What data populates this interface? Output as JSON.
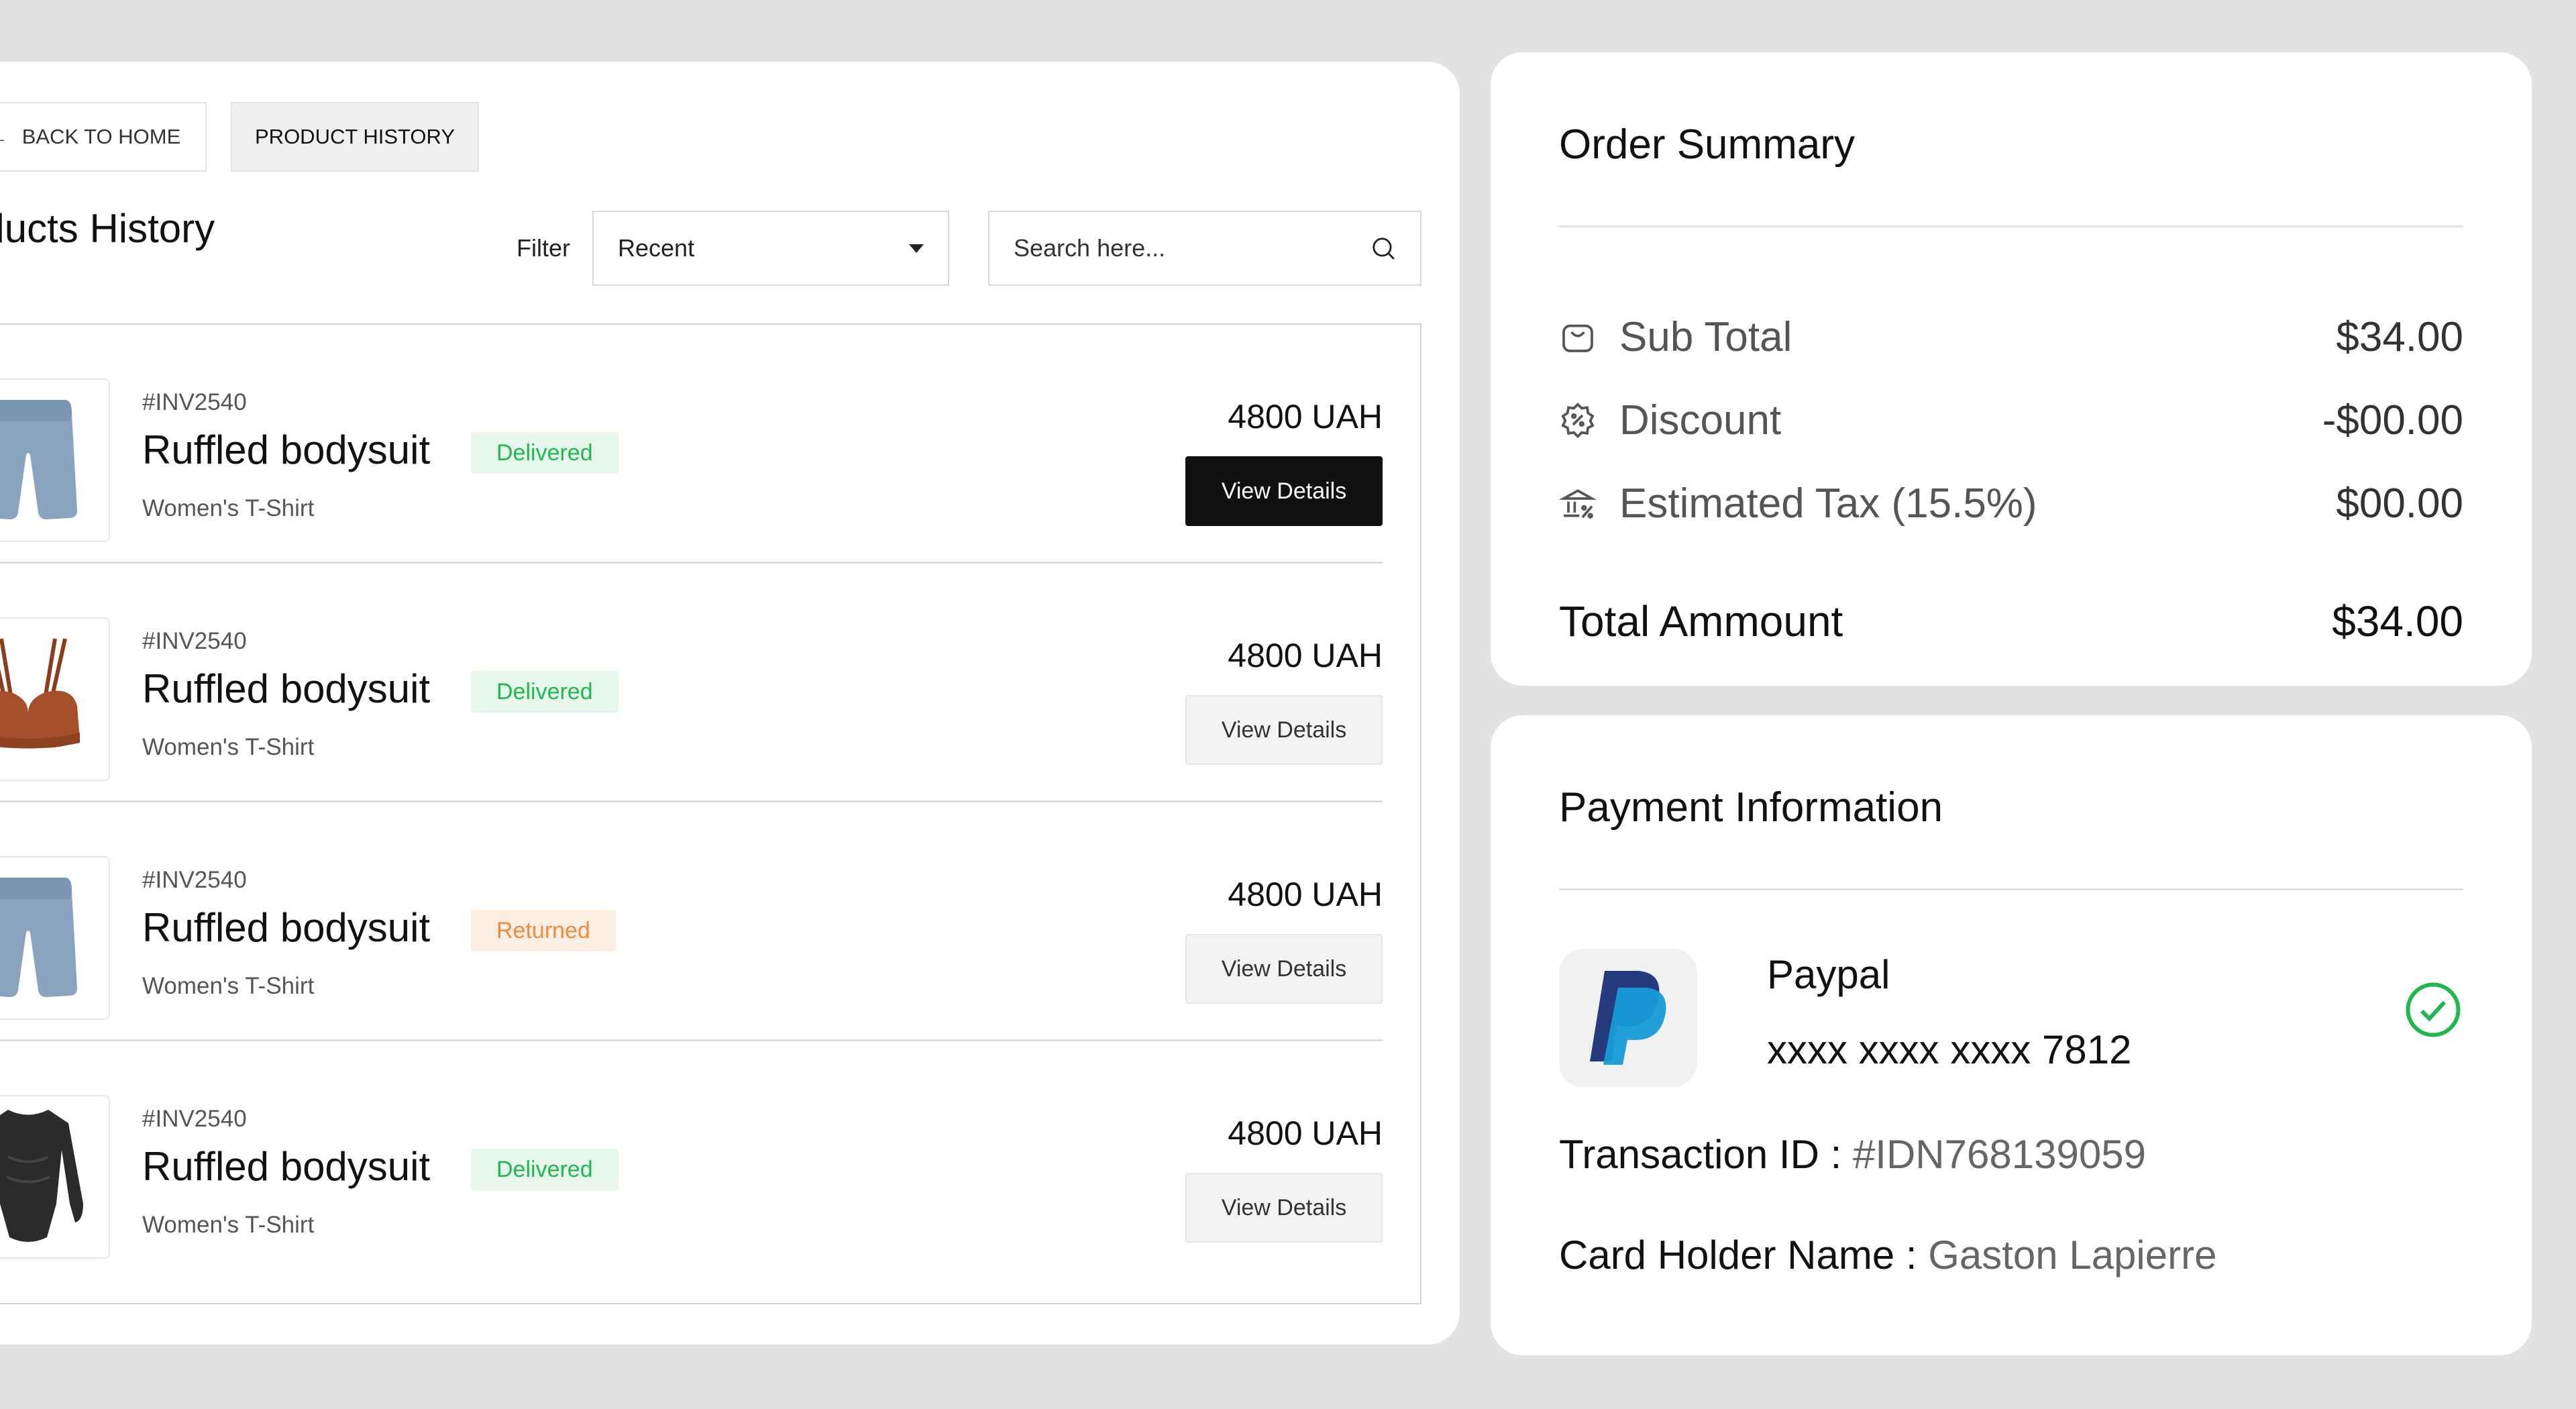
{
  "breadcrumb": {
    "back_label": "BACK TO HOME",
    "current_label": "PRODUCT HISTORY"
  },
  "products": {
    "title": "Products History",
    "filter_label": "Filter",
    "filter_value": "Recent",
    "search_placeholder": "Search here...",
    "items": [
      {
        "invoice": "#INV2540",
        "name": "Ruffled bodysuit",
        "status": "Delivered",
        "category": "Women's T-Shirt",
        "price": "4800 UAH",
        "button": "View Details",
        "image": "shorts-image"
      },
      {
        "invoice": "#INV2540",
        "name": "Ruffled bodysuit",
        "status": "Delivered",
        "category": "Women's T-Shirt",
        "price": "4800 UAH",
        "button": "View Details",
        "image": "bra-image"
      },
      {
        "invoice": "#INV2540",
        "name": "Ruffled bodysuit",
        "status": "Returned",
        "category": "Women's T-Shirt",
        "price": "4800 UAH",
        "button": "View Details",
        "image": "shorts-image"
      },
      {
        "invoice": "#INV2540",
        "name": "Ruffled bodysuit",
        "status": "Delivered",
        "category": "Women's T-Shirt",
        "price": "4800 UAH",
        "button": "View Details",
        "image": "bodysuit-image"
      }
    ]
  },
  "order_summary": {
    "title": "Order Summary",
    "rows": [
      {
        "label": "Sub Total",
        "value": "$34.00",
        "icon": "bag-icon"
      },
      {
        "label": "Discount",
        "value": "-$00.00",
        "icon": "discount-badge-icon"
      },
      {
        "label": "Estimated Tax (15.5%)",
        "value": "$00.00",
        "icon": "bank-tax-icon"
      }
    ],
    "total_label": "Total Ammount",
    "total_value": "$34.00"
  },
  "payment": {
    "title": "Payment Information",
    "method": "Paypal",
    "card_number": "xxxx xxxx xxxx 7812",
    "transaction_label": "Transaction ID :",
    "transaction_value": "#IDN768139059",
    "holder_label": "Card Holder Name :",
    "holder_value": "Gaston Lapierre"
  },
  "colors": {
    "delivered": "#1fb84e",
    "returned": "#f08a3c",
    "paypal_dark": "#253b80",
    "paypal_light": "#179bd7"
  }
}
